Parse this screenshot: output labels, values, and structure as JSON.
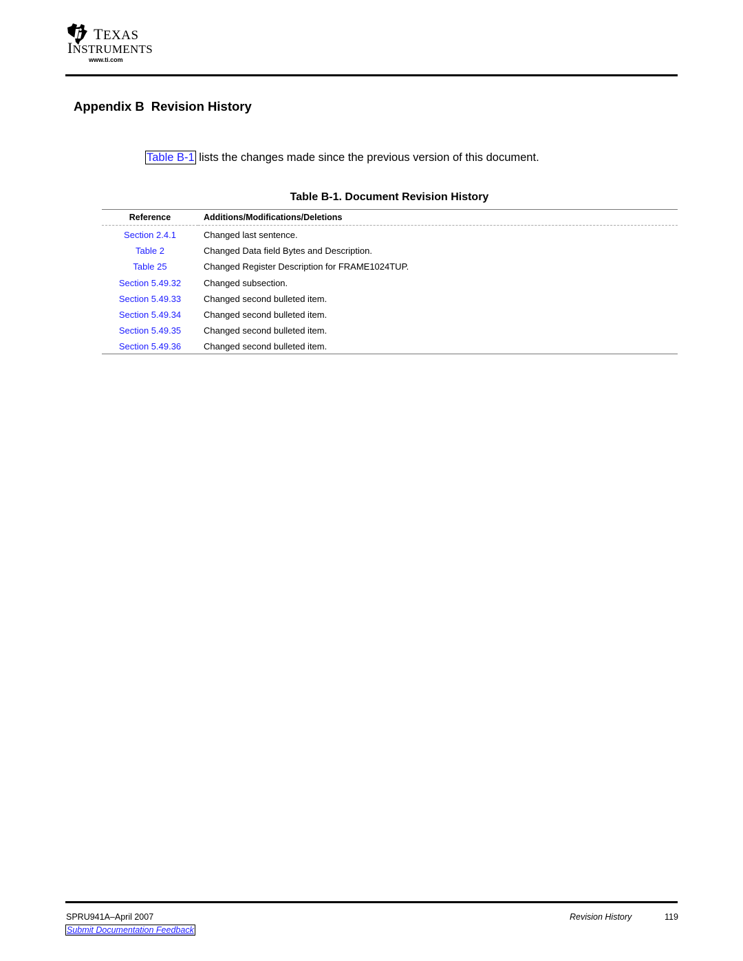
{
  "header": {
    "logo": {
      "icon": "ti-texas-logo-icon",
      "line1_cap": "T",
      "line1_rest": "EXAS",
      "line2_cap": "I",
      "line2_rest": "NSTRUMENTS",
      "url": "www.ti.com"
    }
  },
  "appendix": {
    "label": "Appendix B",
    "title": "Revision History"
  },
  "intro": {
    "xref": "Table B-1",
    "text": " lists the changes made since the previous version of this document."
  },
  "table": {
    "caption": "Table B-1. Document Revision History",
    "columns": [
      "Reference",
      "Additions/Modifications/Deletions"
    ],
    "rows": [
      {
        "reference": "Section 2.4.1",
        "change": "Changed last sentence."
      },
      {
        "reference": "Table 2",
        "change": "Changed Data field Bytes and Description."
      },
      {
        "reference": "Table 25",
        "change": "Changed Register Description for FRAME1024TUP."
      },
      {
        "reference": "Section 5.49.32",
        "change": "Changed subsection."
      },
      {
        "reference": "Section 5.49.33",
        "change": "Changed second bulleted item."
      },
      {
        "reference": "Section 5.49.34",
        "change": "Changed second bulleted item."
      },
      {
        "reference": "Section 5.49.35",
        "change": "Changed second bulleted item."
      },
      {
        "reference": "Section 5.49.36",
        "change": "Changed second bulleted item."
      }
    ]
  },
  "footer": {
    "doc_id": "SPRU941A–April 2007",
    "feedback_link": "Submit Documentation Feedback",
    "section": "Revision History",
    "page_number": "119"
  },
  "colors": {
    "link": "#1a1aff",
    "text": "#000000"
  }
}
